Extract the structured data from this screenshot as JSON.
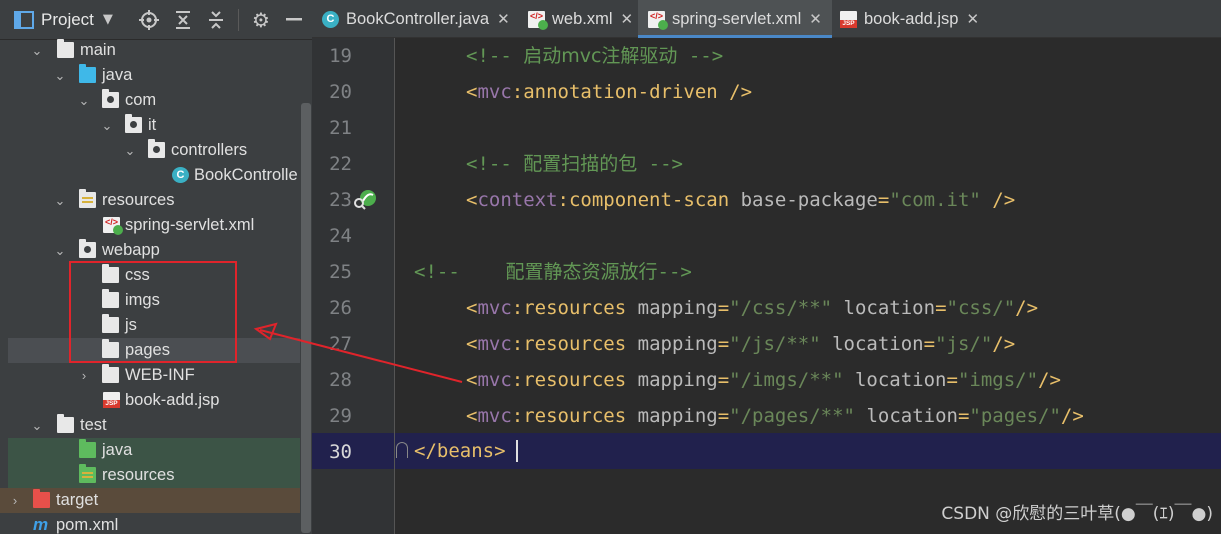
{
  "project": {
    "title": "Project",
    "tree": [
      {
        "label": "main",
        "icon": "folder-icon"
      },
      {
        "label": "java",
        "icon": "source-folder-icon"
      },
      {
        "label": "com",
        "icon": "package-icon"
      },
      {
        "label": "it",
        "icon": "package-icon"
      },
      {
        "label": "controllers",
        "icon": "package-icon"
      },
      {
        "label": "BookControlle",
        "icon": "class-icon"
      },
      {
        "label": "resources",
        "icon": "resources-folder-icon"
      },
      {
        "label": "spring-servlet.xml",
        "icon": "xml-file-icon"
      },
      {
        "label": "webapp",
        "icon": "web-folder-icon"
      },
      {
        "label": "css",
        "icon": "folder-icon"
      },
      {
        "label": "imgs",
        "icon": "folder-icon"
      },
      {
        "label": "js",
        "icon": "folder-icon"
      },
      {
        "label": "pages",
        "icon": "folder-icon"
      },
      {
        "label": "WEB-INF",
        "icon": "folder-icon"
      },
      {
        "label": "book-add.jsp",
        "icon": "jsp-file-icon"
      },
      {
        "label": "test",
        "icon": "folder-icon"
      },
      {
        "label": "java",
        "icon": "test-source-folder-icon"
      },
      {
        "label": "resources",
        "icon": "test-resources-folder-icon"
      },
      {
        "label": "target",
        "icon": "excluded-folder-icon"
      },
      {
        "label": "pom.xml",
        "icon": "maven-icon"
      }
    ]
  },
  "tabs": [
    {
      "label": "BookController.java",
      "icon": "class-icon"
    },
    {
      "label": "web.xml",
      "icon": "xml-file-icon"
    },
    {
      "label": "spring-servlet.xml",
      "icon": "xml-file-icon",
      "active": true
    },
    {
      "label": "book-add.jsp",
      "icon": "jsp-file-icon"
    }
  ],
  "tab_close_glyph": "✕",
  "editor": {
    "line_numbers": [
      "19",
      "20",
      "21",
      "22",
      "23",
      "24",
      "25",
      "26",
      "27",
      "28",
      "29",
      "30"
    ],
    "current_line": "30",
    "lines": {
      "l19": {
        "open": "<!-- ",
        "text": "启动mvc注解驱动",
        "close": " -->"
      },
      "l20": {
        "lt": "<",
        "ns": "mvc",
        "colon": ":",
        "tag": "annotation-driven",
        "end": " />"
      },
      "l22": {
        "open": "<!-- ",
        "text": "配置扫描的包",
        "close": " -->"
      },
      "l23": {
        "lt": "<",
        "ns": "context",
        "colon": ":",
        "tag": "component-scan",
        "attr": " base-package",
        "eq": "=",
        "val": "\"com.it\"",
        "end": " />"
      },
      "l25": {
        "open": "<!--    ",
        "text": "配置静态资源放行",
        "close": "-->"
      },
      "l26": {
        "lt": "<",
        "ns": "mvc",
        "colon": ":",
        "tag": "resources",
        "a1": " mapping",
        "v1": "\"/css/**\"",
        "a2": " location",
        "v2": "\"css/\"",
        "end": "/>"
      },
      "l27": {
        "lt": "<",
        "ns": "mvc",
        "colon": ":",
        "tag": "resources",
        "a1": " mapping",
        "v1": "\"/js/**\"",
        "a2": " location",
        "v2": "\"js/\"",
        "end": "/>"
      },
      "l28": {
        "lt": "<",
        "ns": "mvc",
        "colon": ":",
        "tag": "resources",
        "a1": " mapping",
        "v1": "\"/imgs/**\"",
        "a2": " location",
        "v2": "\"imgs/\"",
        "end": "/>"
      },
      "l29": {
        "lt": "<",
        "ns": "mvc",
        "colon": ":",
        "tag": "resources",
        "a1": " mapping",
        "v1": "\"/pages/**\"",
        "a2": " location",
        "v2": "\"pages/\"",
        "end": "/>"
      },
      "l30": {
        "text": "</beans>"
      }
    }
  },
  "watermark": "CSDN @欣慰的三叶草(●￣(ｴ)￣●)",
  "colors": {
    "annotation": "#e0242b",
    "active_tab_underline": "#4a88c7",
    "current_line_bg": "#21214d"
  }
}
